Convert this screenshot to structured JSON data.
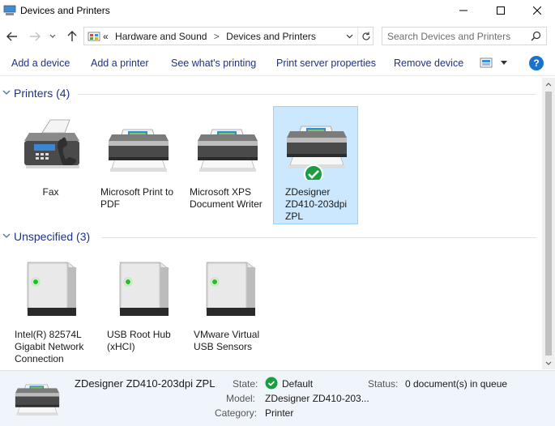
{
  "window": {
    "title": "Devices and Printers"
  },
  "address": {
    "overflow": "«",
    "crumbs": [
      "Hardware and Sound",
      "Devices and Printers"
    ],
    "separator": ">"
  },
  "search": {
    "placeholder": "Search Devices and Printers"
  },
  "commands": {
    "add_device": "Add a device",
    "add_printer": "Add a printer",
    "see_printing": "See what's printing",
    "print_server": "Print server properties",
    "remove_device": "Remove device",
    "help": "?"
  },
  "groups": [
    {
      "title": "Printers (4)",
      "items": [
        {
          "label": "Fax",
          "icon": "fax-icon",
          "selected": false
        },
        {
          "label": "Microsoft Print to PDF",
          "icon": "printer-icon",
          "selected": false
        },
        {
          "label": "Microsoft XPS Document Writer",
          "icon": "printer-icon",
          "selected": false
        },
        {
          "label": "ZDesigner ZD410-203dpi ZPL",
          "icon": "printer-default-icon",
          "selected": true
        }
      ]
    },
    {
      "title": "Unspecified (3)",
      "items": [
        {
          "label": "Intel(R) 82574L Gigabit Network Connection",
          "icon": "device-tower-icon",
          "selected": false
        },
        {
          "label": "USB Root Hub (xHCI)",
          "icon": "device-tower-icon",
          "selected": false
        },
        {
          "label": "VMware Virtual USB Sensors",
          "icon": "device-tower-icon",
          "selected": false
        }
      ]
    }
  ],
  "details": {
    "name": "ZDesigner ZD410-203dpi ZPL",
    "state_label": "State:",
    "state_value": "Default",
    "status_label": "Status:",
    "status_value": "0 document(s) in queue",
    "model_label": "Model:",
    "model_value": "ZDesigner ZD410-203...",
    "category_label": "Category:",
    "category_value": "Printer"
  },
  "colors": {
    "link_blue": "#1e3287",
    "selection_bg": "#cce8ff",
    "selection_border": "#99d1ff",
    "default_check_green": "#1a9e3f",
    "details_bg": "#f0f5fb"
  }
}
